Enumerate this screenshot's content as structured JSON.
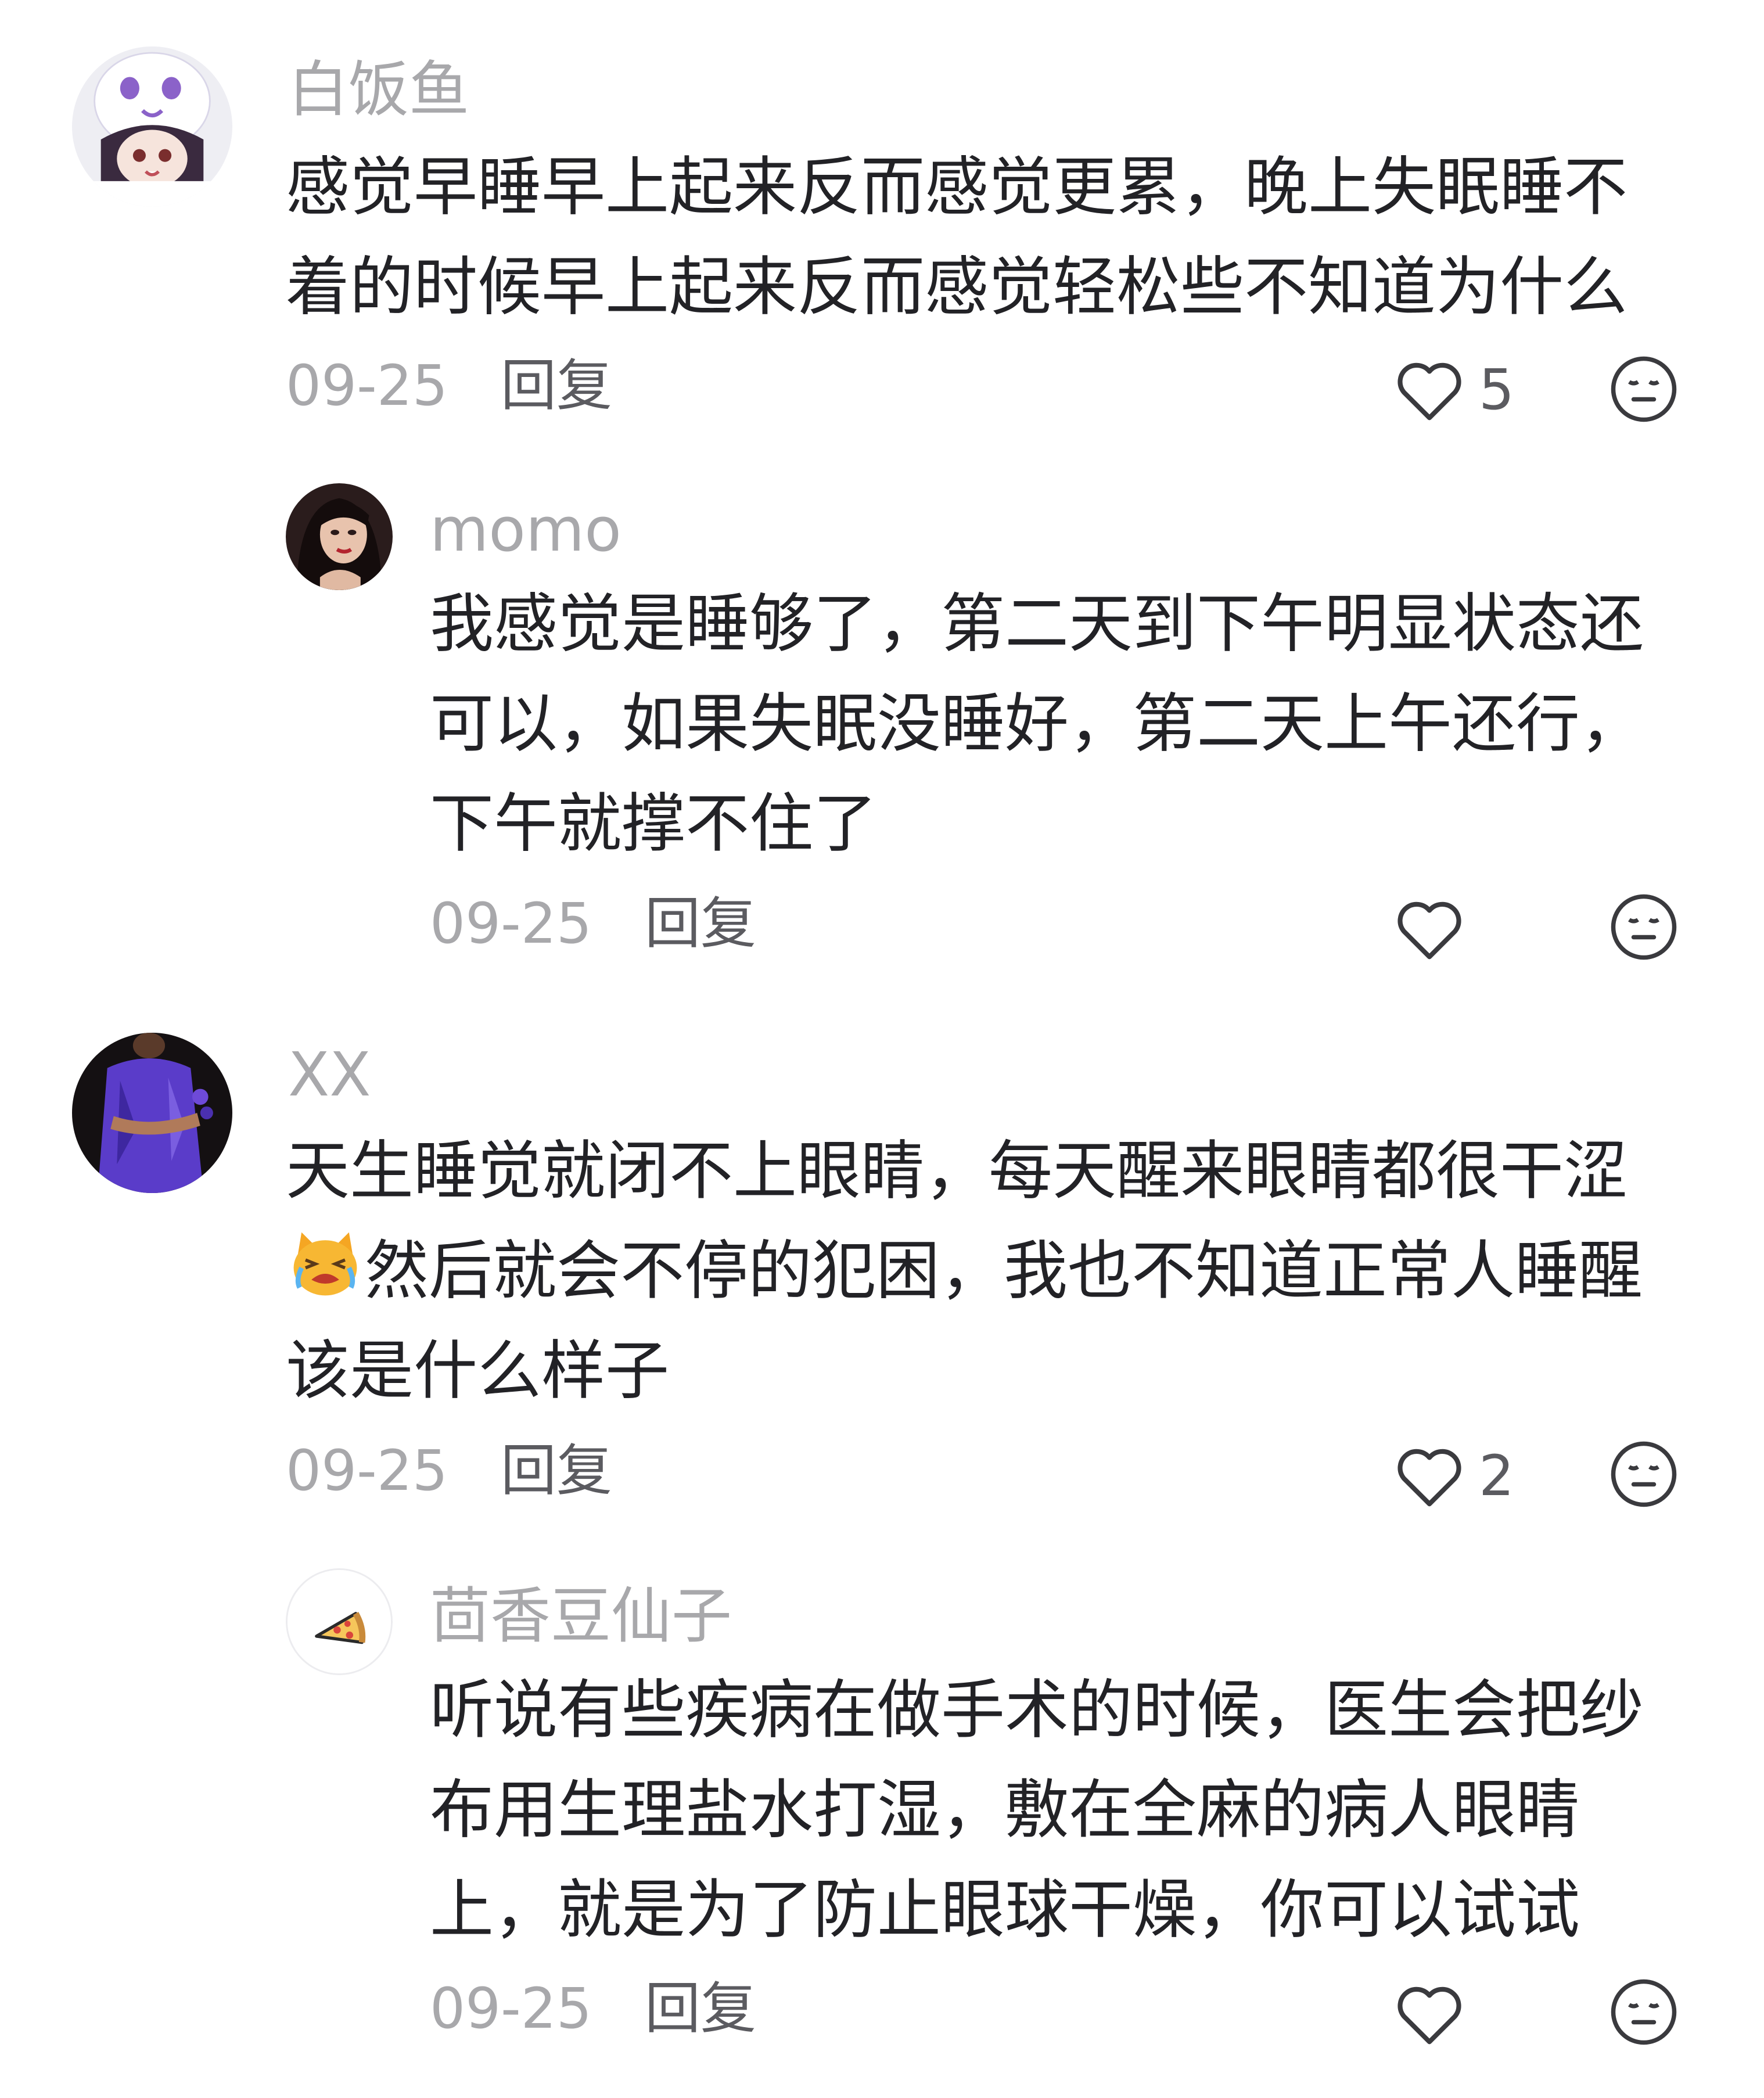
{
  "comments": [
    {
      "username": "白饭鱼",
      "text": "感觉早睡早上起来反而感觉更累，晚上失眠睡不着的时候早上起来反而感觉轻松些不知道为什么",
      "date": "09-25",
      "reply_label": "回复",
      "likes": "5"
    },
    {
      "username": "momo",
      "text": "我感觉是睡够了，第二天到下午明显状态还可以，如果失眠没睡好，第二天上午还行，下午就撑不住了",
      "date": "09-25",
      "reply_label": "回复",
      "likes": ""
    },
    {
      "username": "XX",
      "text_part1": "天生睡觉就闭不上眼睛，每天醒来眼睛都很干涩",
      "text_part2": "然后就会不停的犯困，我也不知道正常人睡醒该是什么样子",
      "date": "09-25",
      "reply_label": "回复",
      "likes": "2"
    },
    {
      "username": "茴香豆仙子",
      "text": "听说有些疾病在做手术的时候，医生会把纱布用生理盐水打湿，敷在全麻的病人眼睛上，就是为了防止眼球干燥，你可以试试",
      "date": "09-25",
      "reply_label": "回复",
      "likes": ""
    }
  ],
  "icons": {
    "like": "heart-outline-icon",
    "dislike": "meh-face-icon",
    "crying_cat": "crying-cat-emoji"
  },
  "colors": {
    "username": "#a8a8ab",
    "text": "#222226",
    "meta": "#a8a8ab",
    "icon_stroke": "#3a3a3e"
  }
}
